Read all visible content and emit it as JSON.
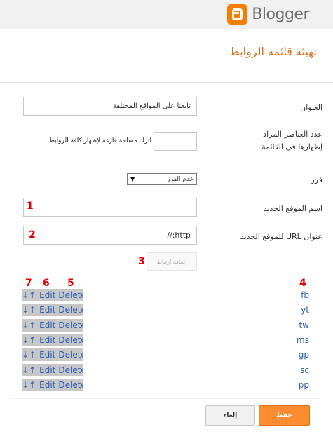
{
  "app": {
    "logo_text": "Blogger"
  },
  "page_title": "تهيئة قائمة الروابط",
  "form": {
    "title_label": "العنوان",
    "title_value": "تابعنا على المواقع المختلفة",
    "count_label": "عدد العناصر المراد إظهارها في القائمة",
    "count_value": "",
    "count_hint": "اترك مساحة فارغة لإظهار كافة الروابط",
    "sort_label": "فرز",
    "sort_value": "عدم الفرز",
    "new_site_name_label": "اسم الموقع الجديد",
    "new_site_name_value": "",
    "new_site_url_label": "عنوان URL للموقع الجديد",
    "new_site_url_value": "http://",
    "add_link_button": "إضافة ارتباط"
  },
  "markers": [
    "1",
    "2",
    "3",
    "4",
    "5",
    "6",
    "7"
  ],
  "links": {
    "controls": {
      "down": "↓",
      "up": "↑",
      "edit": "Edit",
      "delete": "Delete"
    },
    "items": [
      {
        "name": "fb"
      },
      {
        "name": "yt"
      },
      {
        "name": "tw"
      },
      {
        "name": "ms"
      },
      {
        "name": "gp"
      },
      {
        "name": "sc"
      },
      {
        "name": "pp"
      }
    ]
  },
  "footer": {
    "cancel_button": "إلغاء",
    "save_button": "حفظ"
  },
  "colors": {
    "accent_orange": "#dd6f1a",
    "save_button_bg": "#fb8c2f",
    "link_blue": "#2a5cb8",
    "marker_red": "#e60000",
    "logo_orange": "#f57d00"
  }
}
